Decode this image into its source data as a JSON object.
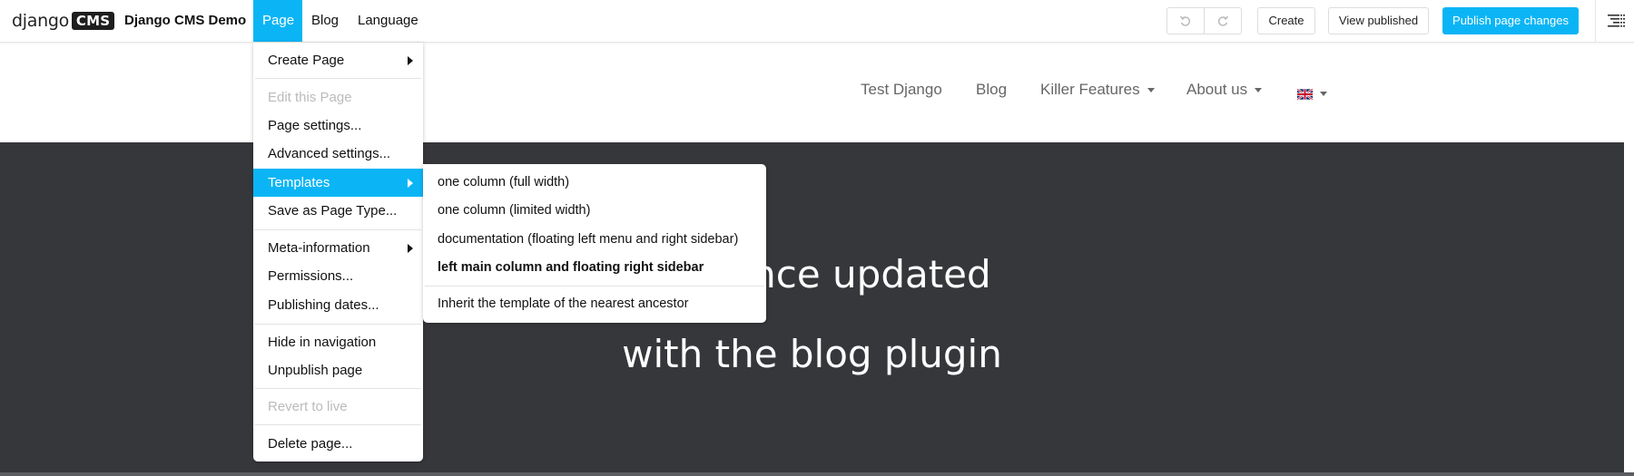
{
  "toolbar": {
    "logo": {
      "text": "django",
      "badge": "CMS"
    },
    "site_name": "Django CMS Demo",
    "menus": [
      {
        "label": "Page",
        "active": true
      },
      {
        "label": "Blog",
        "active": false
      },
      {
        "label": "Language",
        "active": false
      }
    ],
    "buttons": {
      "undo_icon": "undo-icon",
      "redo_icon": "redo-icon",
      "create": "Create",
      "view_published": "View published",
      "publish": "Publish page changes"
    },
    "sidebar_toggle_icon": "structure-toggle-icon",
    "accent_color": "#0bb5f5"
  },
  "page_menu": {
    "items": [
      {
        "label": "Create Page",
        "submenu": true,
        "disabled": false
      },
      {
        "label": "Edit this Page",
        "submenu": false,
        "disabled": true
      },
      {
        "label": "Page settings...",
        "submenu": false,
        "disabled": false
      },
      {
        "label": "Advanced settings...",
        "submenu": false,
        "disabled": false
      },
      {
        "label": "Templates",
        "submenu": true,
        "disabled": false,
        "active": true
      },
      {
        "label": "Save as Page Type...",
        "submenu": false,
        "disabled": false
      },
      {
        "label": "Meta-information",
        "submenu": true,
        "disabled": false
      },
      {
        "label": "Permissions...",
        "submenu": false,
        "disabled": false
      },
      {
        "label": "Publishing dates...",
        "submenu": false,
        "disabled": false
      },
      {
        "label": "Hide in navigation",
        "submenu": false,
        "disabled": false
      },
      {
        "label": "Unpublish page",
        "submenu": false,
        "disabled": false
      },
      {
        "label": "Revert to live",
        "submenu": false,
        "disabled": true
      },
      {
        "label": "Delete page...",
        "submenu": false,
        "disabled": false
      }
    ]
  },
  "templates_submenu": {
    "items": [
      {
        "label": "one column (full width)",
        "selected": false
      },
      {
        "label": "one column (limited width)",
        "selected": false
      },
      {
        "label": "documentation (floating left menu and right sidebar)",
        "selected": false
      },
      {
        "label": "left main column and floating right sidebar",
        "selected": true
      },
      {
        "label": "Inherit the template of the nearest ancestor",
        "selected": false
      }
    ]
  },
  "site_nav": {
    "links": [
      {
        "label": "Test Django",
        "dropdown": false
      },
      {
        "label": "Blog",
        "dropdown": false
      },
      {
        "label": "Killer Features",
        "dropdown": true
      },
      {
        "label": "About us",
        "dropdown": true
      }
    ],
    "language_flag": "uk-flag-icon"
  },
  "hero": {
    "line1": "...udience updated",
    "line2": "with the blog plugin"
  }
}
